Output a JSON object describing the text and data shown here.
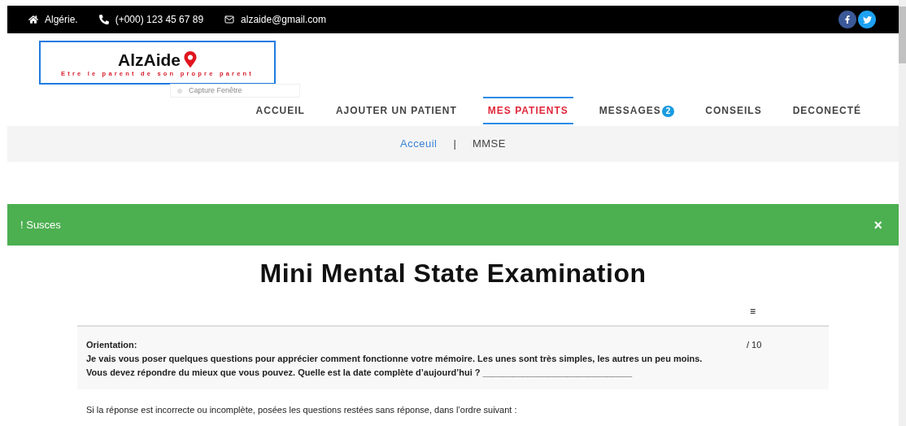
{
  "topbar": {
    "location": "Algérie.",
    "phone": "(+000) 123 45 67 89",
    "email": "alzaide@gmail.com"
  },
  "logo": {
    "name": "AlzAide",
    "tagline": "Etre le parent de son propre parent"
  },
  "overlay": {
    "label": "Capture Fenêtre"
  },
  "nav": [
    {
      "label": "ACCUEIL",
      "selected": false
    },
    {
      "label": "AJOUTER UN PATIENT",
      "selected": false
    },
    {
      "label": "MES PATIENTS",
      "selected": true
    },
    {
      "label": "MESSAGES",
      "selected": false,
      "badge": "2"
    },
    {
      "label": "CONSEILS",
      "selected": false
    },
    {
      "label": "DECONECTÉ",
      "selected": false
    }
  ],
  "breadcrumb": {
    "link": "Acceuil",
    "separator": "|",
    "current": "MMSE"
  },
  "alert": {
    "message": "! Susces",
    "close": "×"
  },
  "title": "Mini Mental State Examination",
  "table": {
    "header_mark": "≡",
    "rows": [
      {
        "kind": "question",
        "heading": "Orientation:",
        "text": "Je vais vous poser quelques questions pour apprécier comment fonctionne votre mémoire. Les unes sont très simples, les autres un peu moins. Vous devez répondre du mieux que vous pouvez. Quelle est la date complète d’aujourd’hui ? ______________________________",
        "score": "/ 10"
      },
      {
        "kind": "note",
        "text": "Si la réponse est incorrecte ou incomplète, posées les questions restées sans réponse, dans l’ordre suivant :"
      }
    ]
  }
}
